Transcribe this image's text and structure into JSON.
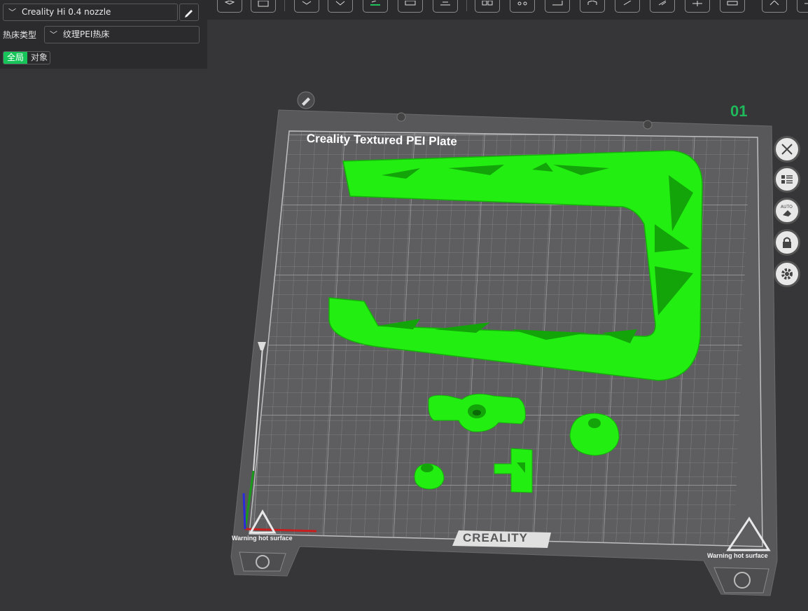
{
  "left_panel": {
    "nozzle_value": "Creality Hi 0.4 nozzle",
    "bed_type_label": "热床类型",
    "bed_type_value": "纹理PEI热床",
    "scope_tabs": [
      "全局",
      "对象"
    ]
  },
  "plate": {
    "name": "Creality Textured PEI Plate",
    "number": "01",
    "brand": "CREALITY",
    "warning_left": "Warning hot surface",
    "warning_right": "Warning hot surface"
  },
  "icons": {
    "toolbar": [
      "cube-icon",
      "grid-icon",
      "add-plate-icon",
      "orient-icon",
      "arrange-icon",
      "split-icon",
      "layers-icon",
      "objects-icon",
      "settings-icon",
      "measure-icon",
      "view-icon",
      "edit-icon",
      "cut-icon",
      "paint-icon",
      "seam-icon",
      "support-icon",
      "more-icon"
    ],
    "side": [
      "close-icon",
      "list-icon",
      "auto-eraser-icon",
      "lock-icon",
      "gear-icon"
    ]
  },
  "colors": {
    "model": "#22ee11",
    "accent": "#17c45a",
    "plate": "#5a5a5c",
    "background": "#363638"
  }
}
